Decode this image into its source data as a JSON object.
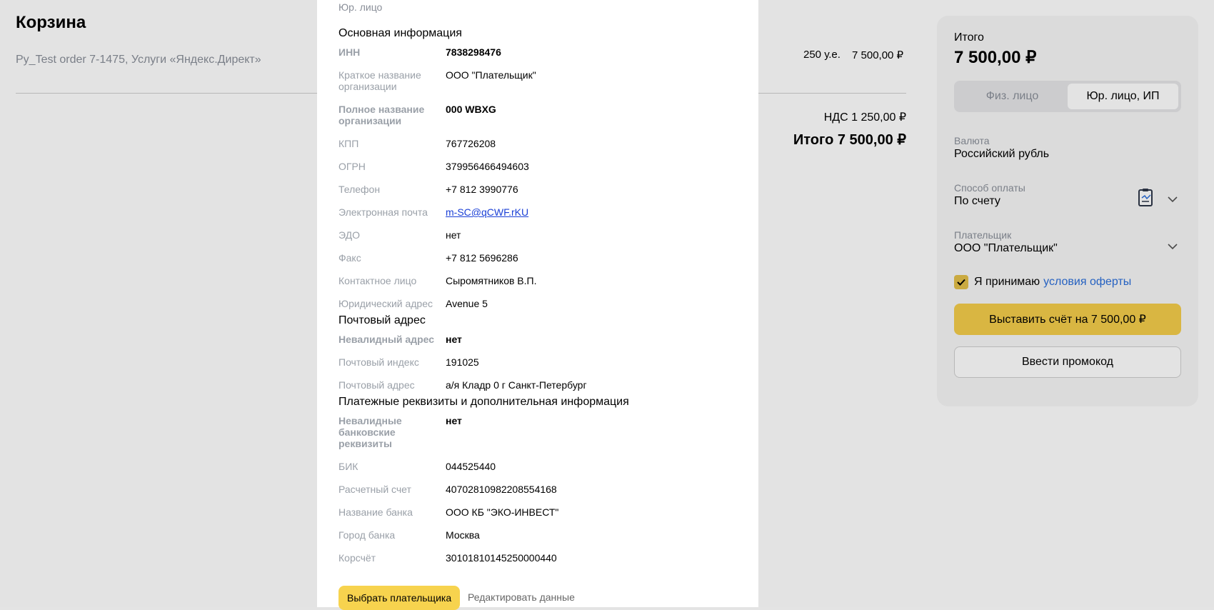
{
  "page": {
    "title": "Корзина",
    "order_description": "Py_Test order 7-1475, Услуги «Яндекс.Директ»",
    "order_quantity": "250 у.е.",
    "order_price": "7 500,00 ₽",
    "vat": "НДС 1 250,00 ₽",
    "total": "Итого 7 500,00 ₽"
  },
  "summary": {
    "label": "Итого",
    "amount": "7 500,00 ₽",
    "segments": [
      {
        "label": "Физ. лицо",
        "active": false
      },
      {
        "label": "Юр. лицо, ИП",
        "active": true
      }
    ],
    "currency_label": "Валюта",
    "currency_value": "Российский рубль",
    "payment_label": "Способ оплаты",
    "payment_value": "По счету",
    "payer_label": "Плательщик",
    "payer_value": "ООО \"Плательщик\"",
    "accept_text": "Я принимаю",
    "accept_link": "условия оферты",
    "invoice_button": "Выставить счёт на 7 500,00 ₽",
    "promo_button": "Ввести промокод",
    "accent_color": "#f4cd4b"
  },
  "modal": {
    "subtitle": "Юр. лицо",
    "section_main": "Основная информация",
    "main_rows": [
      {
        "label": "ИНН",
        "value": "7838298476",
        "bold": true
      },
      {
        "label": "Краткое название организации",
        "value": "ООО \"Плательщик\"",
        "bold": false
      },
      {
        "label": "Полное название организации",
        "value": "000 WBXG",
        "bold": true
      },
      {
        "label": "КПП",
        "value": "767726208",
        "bold": false
      },
      {
        "label": "ОГРН",
        "value": "379956466494603",
        "bold": false
      },
      {
        "label": "Телефон",
        "value": "+7 812 3990776",
        "bold": false
      },
      {
        "label": "Электронная почта",
        "value": "m-SC@qCWF.rKU",
        "bold": false,
        "link": true
      },
      {
        "label": "ЭДО",
        "value": "нет",
        "bold": false
      },
      {
        "label": "Факс",
        "value": "+7 812 5696286",
        "bold": false
      },
      {
        "label": "Контактное лицо",
        "value": "Сыромятников В.П.",
        "bold": false
      },
      {
        "label": "Юридический адрес",
        "value": "Avenue 5",
        "bold": false
      }
    ],
    "section_postal": "Почтовый адрес",
    "postal_rows": [
      {
        "label": "Невалидный адрес",
        "value": "нет",
        "bold": true
      },
      {
        "label": "Почтовый индекс",
        "value": "191025",
        "bold": false
      },
      {
        "label": "Почтовый адрес",
        "value": "а/я Кладр 0 г Санкт-Петербург",
        "bold": false
      }
    ],
    "section_bank": "Платежные реквизиты и дополнительная информация",
    "bank_rows": [
      {
        "label": "Невалидные банковские реквизиты",
        "value": "нет",
        "bold": true
      },
      {
        "label": "БИК",
        "value": "044525440",
        "bold": false
      },
      {
        "label": "Расчетный счет",
        "value": "40702810982208554168",
        "bold": false
      },
      {
        "label": "Название банка",
        "value": "ООО КБ \"ЭКО-ИНВЕСТ\"",
        "bold": false
      },
      {
        "label": "Город банка",
        "value": "Москва",
        "bold": false
      },
      {
        "label": "Корсчёт",
        "value": "30101810145250000440",
        "bold": false
      }
    ],
    "select_button": "Выбрать плательщика",
    "edit_link": "Редактировать данные"
  }
}
